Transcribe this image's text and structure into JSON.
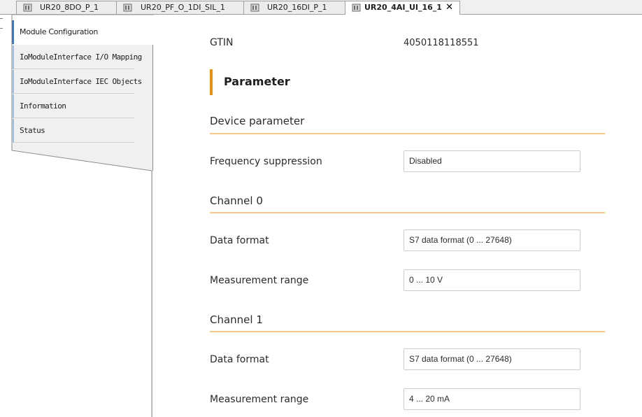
{
  "tabs": [
    {
      "label": "UR20_8DO_P_1",
      "active": false
    },
    {
      "label": "UR20_PF_O_1DI_SIL_1",
      "active": false
    },
    {
      "label": "UR20_16DI_P_1",
      "active": false
    },
    {
      "label": "UR20_4AI_UI_16_1",
      "active": true,
      "closable": true
    }
  ],
  "tab_icon": "module-icon",
  "close_glyph": "✕",
  "nav": {
    "items": [
      {
        "label": "Module Configuration",
        "active": true
      },
      {
        "label": "IoModuleInterface I/O Mapping"
      },
      {
        "label": "IoModuleInterface IEC Objects"
      },
      {
        "label": "Information"
      },
      {
        "label": "Status"
      }
    ]
  },
  "colors": {
    "accent_orange": "#e8900f",
    "section_rule": "#f5c98a",
    "nav_active_bar": "#2f7ad4",
    "nav_bar": "#9ec2e6"
  },
  "main": {
    "gtin_label": "GTIN",
    "gtin_value": "4050118118551",
    "parameter_title": "Parameter",
    "sections": [
      {
        "title": "Device parameter",
        "rows": [
          {
            "label": "Frequency suppression",
            "value": "Disabled"
          }
        ]
      },
      {
        "title": "Channel 0",
        "rows": [
          {
            "label": "Data format",
            "value": "S7 data format (0 ... 27648)"
          },
          {
            "label": "Measurement range",
            "value": "0 ... 10 V"
          }
        ]
      },
      {
        "title": "Channel 1",
        "rows": [
          {
            "label": "Data format",
            "value": "S7 data format (0 ... 27648)"
          },
          {
            "label": "Measurement range",
            "value": "4 ... 20 mA"
          }
        ]
      }
    ]
  }
}
